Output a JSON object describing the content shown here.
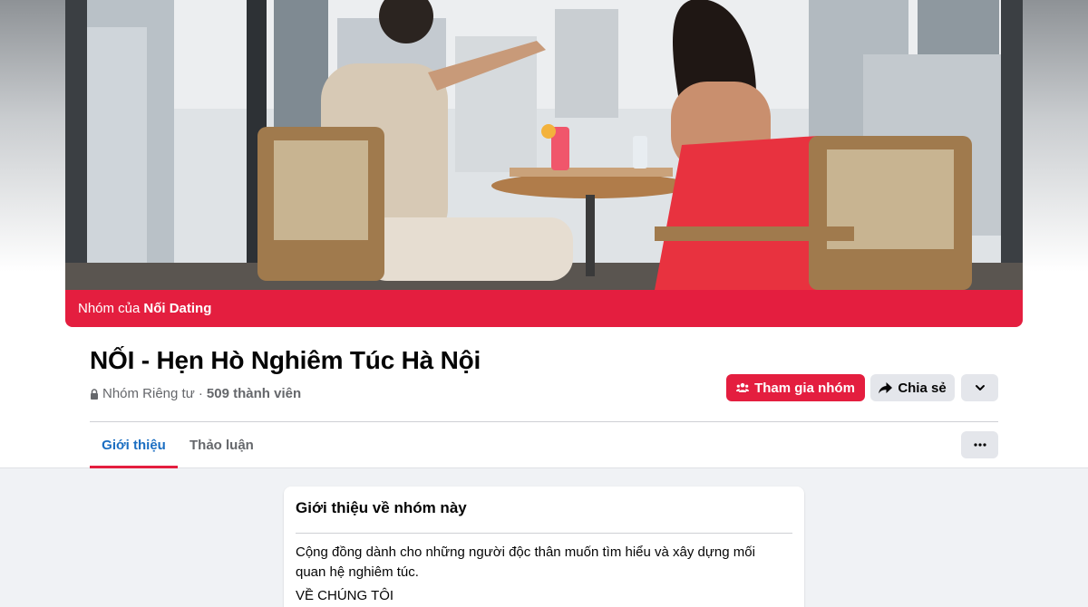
{
  "cover": {
    "banner_prefix": "Nhóm của",
    "banner_owner": "Nối Dating"
  },
  "group": {
    "title": "NỐI - Hẹn Hò Nghiêm Túc Hà Nội",
    "privacy": "Nhóm Riêng tư ·",
    "members": "509 thành viên"
  },
  "actions": {
    "join_label": "Tham gia nhóm",
    "share_label": "Chia sẻ"
  },
  "tabs": [
    {
      "label": "Giới thiệu",
      "active": true
    },
    {
      "label": "Thảo luận",
      "active": false
    }
  ],
  "about": {
    "title": "Giới thiệu về nhóm này",
    "description": "Cộng đồng dành cho những người độc thân muốn tìm hiểu và xây dựng mối quan hệ nghiêm túc.",
    "subheading": "VỀ CHÚNG TÔI"
  },
  "colors": {
    "brand": "#e41e3f",
    "active_tab_text": "#1b6ec2",
    "secondary_button": "#e4e6eb"
  },
  "icons": [
    "lock-icon",
    "group-icon",
    "share-arrow-icon",
    "chevron-down-icon",
    "more-dots-icon"
  ]
}
